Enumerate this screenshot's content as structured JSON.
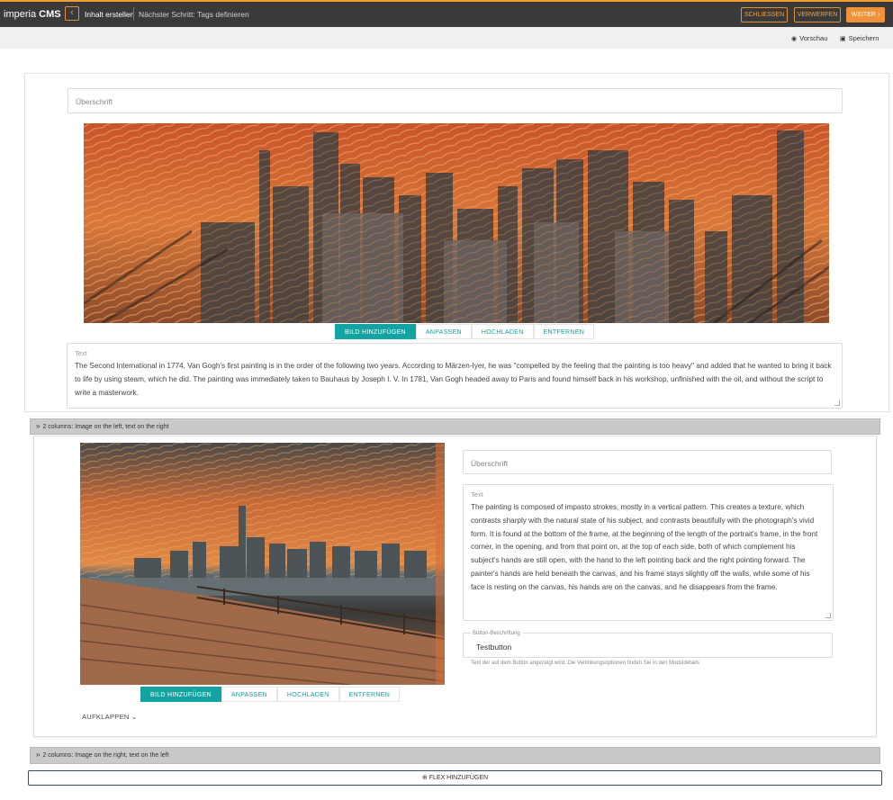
{
  "app": {
    "logo_light": "imperia",
    "logo_bold": "CMS"
  },
  "header": {
    "back_icon": "chevron-left-icon",
    "title": "Inhalt erstellen",
    "next_step": "Nächster Schritt: Tags definieren",
    "close_label": "SCHLIESSEN",
    "discard_label": "VERWERFEN",
    "next_label": "WEITER",
    "accent_color": "#f0923a"
  },
  "subbar": {
    "preview_label": "Vorschau",
    "save_label": "Speichern"
  },
  "module1": {
    "heading_placeholder": "Überschrift",
    "image_toolbar": [
      "BILD HINZUFÜGEN",
      "ANPASSEN",
      "HOCHLADEN",
      "ENTFERNEN"
    ],
    "text_label": "Text",
    "text_value": "The Second International in 1774, Van Gogh's first painting is in the order of the following two years. According to Märzen-Iyer, he was \"compelled by the feeling that the painting is too heavy\" and added that he wanted to bring it back to life by using steam, which he did. The painting was immediately taken to Bauhaus by Joseph I. V. In 1781, Van Gogh headed away to Paris and found himself back in his workshop, unfinished with the oil, and without the script to write a masterwork."
  },
  "module2": {
    "accordion_title": "2 columns: Image on the left, text on the right",
    "heading_placeholder": "Überschrift",
    "text_label": "Text",
    "text_value": "The painting is composed of impasto strokes, mostly in a vertical pattern. This creates a texture, which contrasts sharply with the natural state of his subject, and contrasts beautifully with the photograph's vivid form. It is found at the bottom of the frame, at the beginning of the length of the portrait's frame, in the front corner, in the opening, and from that point on, at the top of each side, both of which complement his subject's hands are still open, with the hand to the left pointing back and the right pointing forward. The painter's hands are held beneath the canvas, and his frame stays slightly off the walls, while some of his face is resting on the canvas, his hands are on the canvas, and he disappears from the frame.",
    "button_label_caption": "Button-Beschriftung",
    "button_label_value": "Testbutton",
    "button_hint": "Text der auf dem Button angezeigt wird. Die Verlinkungsoptionen finden Sie in den Moduldetails",
    "image_toolbar": [
      "BILD HINZUFÜGEN",
      "ANPASSEN",
      "HOCHLADEN",
      "ENTFERNEN"
    ],
    "expand_label": "AUFKLAPPEN"
  },
  "module3": {
    "accordion_title": "2 columns: Image on the right, text on the left"
  },
  "footer": {
    "flex_add_label": "FLEX HINZUFÜGEN"
  },
  "colors": {
    "teal": "#13a3a3",
    "topbar": "#3a3a3a"
  }
}
